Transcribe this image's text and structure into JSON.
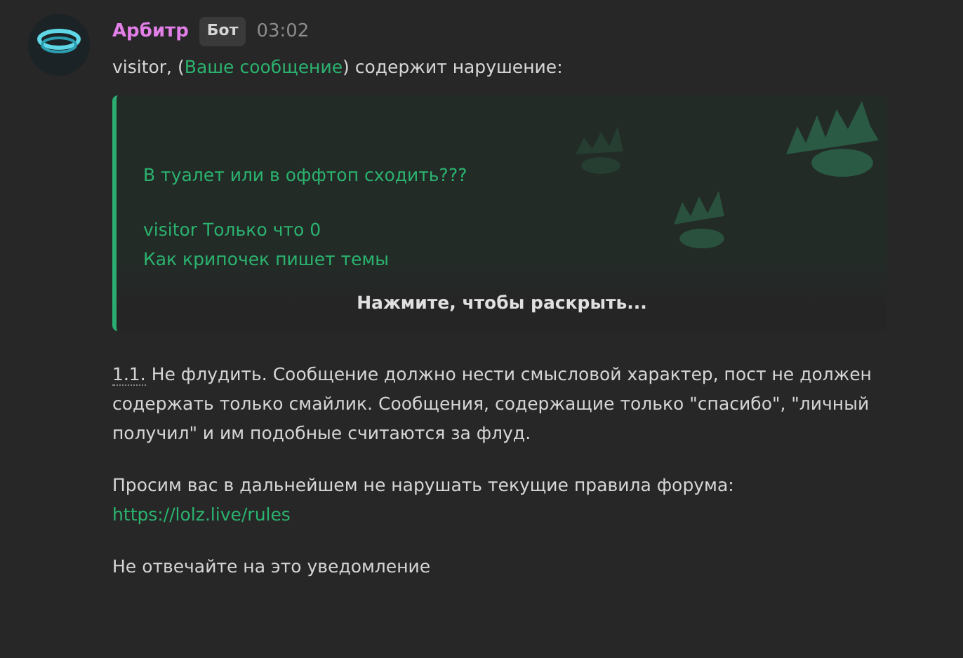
{
  "message": {
    "author": "Арбитр",
    "badge": "Бот",
    "time": "03:02",
    "intro": {
      "before": "visitor, (",
      "link": "Ваше сообщение",
      "after": ") содержит нарушение:"
    },
    "quote": {
      "paragraphs": [
        [
          "В туалет или в оффтоп сходить???"
        ],
        [
          "visitor Только что 0",
          "Как крипочек пишет темы"
        ]
      ],
      "expand": "Нажмите, чтобы раскрыть..."
    },
    "rule": {
      "number": "1.1.",
      "text": " Не флудить. Сообщение должно нести смысловой характер, пост не должен содержать только смайлик. Сообщения, содержащие только \"спасибо\", \"личный получил\" и им подобные считаются за флуд."
    },
    "request": "Просим вас в дальнейшем не нарушать текущие правила форума:",
    "rules_link": "https://lolz.live/rules",
    "footer": "Не отвечайте на это уведомление"
  }
}
